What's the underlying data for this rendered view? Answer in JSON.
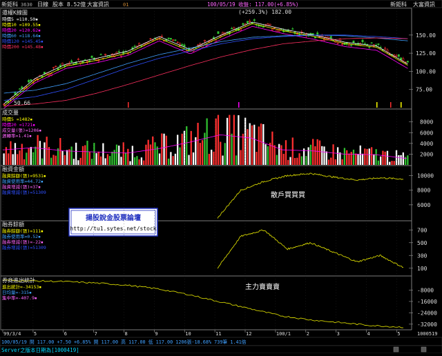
{
  "header": {
    "stock_name": "新鉅科",
    "code": "3630",
    "period": "日線",
    "capital": "股本 8.52億",
    "broker": "大富資訊",
    "page": "01",
    "quote": "100/05/19 收盤: 117.00(+6.85%)",
    "name_right": "新鉅科",
    "broker_right": "大富資訊"
  },
  "colors": {
    "up": "#ff3030",
    "down": "#30c030",
    "ma5": "#ffffff",
    "ma10": "#ffff00",
    "ma20": "#ff00ff",
    "ma60": "#40a0ff",
    "ma120": "#3050ff",
    "ma200": "#ff3060",
    "trace": "#d4d400"
  },
  "panel1": {
    "title": "還權K線圖",
    "legends": [
      "時價5 =110.50▪",
      "時價10 =109.55▪",
      "時價20 =120.62▪",
      "時價60 =118.64▪",
      "時價120 =145.45▪",
      "時價200 =145.48▪"
    ],
    "peak_label": "(+259.3%) 182.00",
    "low_label": "50.66"
  },
  "panel2": {
    "title": "成交量",
    "legends": [
      "時價5 =1482▪",
      "時價20 =1721▪",
      "成交量(張)=1206▪",
      "週轉率=1.41▪"
    ]
  },
  "panel3": {
    "title": "融資金額",
    "legends": [
      "融資餘額(張)=9531▪",
      "融資使用率=44.72▪",
      "融資增減(張)=37▪",
      "融資增減(張)=51309"
    ],
    "annotation": "散戶買買買"
  },
  "panel4": {
    "title": "融券餘額",
    "legends": [
      "融券餘額(張)=111▪",
      "融券使用率=0.52▪",
      "融券增減(張)=-22▪",
      "融券增減(張)=51309"
    ]
  },
  "panel5": {
    "title": "券商進出統計",
    "legends": [
      "進出統計=-34153▪",
      "日均量=-315▪",
      "集中率=-407.9▪"
    ],
    "annotation": "主力賣賣賣"
  },
  "watermark": {
    "title": "揚股說金股票論壇",
    "url": "http://tu1.sytes.net/stock"
  },
  "xaxis": {
    "labels": [
      "99/3/4",
      "5",
      "6",
      "7",
      "8",
      "9",
      "10",
      "11",
      "12",
      "100/1",
      "2",
      "3",
      "4",
      "5"
    ],
    "end_label": "1000519"
  },
  "status": {
    "line1": "100/05/19 開 117.00 +7.50 +6.85% 開 117.00 高 117.00 低 117.00 1206張-18.68% 739筆 1.41倍",
    "line2": "Server之版本日期為[1000419]"
  },
  "chart_data": [
    {
      "type": "line",
      "title": "還權K線圖",
      "x": [
        "99/3/4",
        "5",
        "6",
        "7",
        "8",
        "9",
        "10",
        "11",
        "12",
        "100/1",
        "2",
        "3",
        "4",
        "5"
      ],
      "yticks": [
        150,
        125,
        100,
        75
      ],
      "ylim": [
        50,
        185
      ],
      "series": [
        {
          "name": "時價5",
          "values": [
            55,
            90,
            110,
            118,
            128,
            148,
            130,
            150,
            168,
            158,
            150,
            140,
            135,
            110
          ]
        },
        {
          "name": "時價120",
          "values": [
            60,
            65,
            75,
            90,
            105,
            118,
            128,
            138,
            145,
            148,
            150,
            150,
            148,
            145
          ]
        },
        {
          "name": "時價200",
          "values": [
            52,
            55,
            60,
            70,
            82,
            95,
            108,
            120,
            130,
            138,
            142,
            145,
            146,
            145
          ]
        }
      ]
    },
    {
      "type": "bar",
      "title": "成交量",
      "categories": [
        "99/3/4",
        "5",
        "6",
        "7",
        "8",
        "9",
        "10",
        "11",
        "12",
        "100/1",
        "2",
        "3",
        "4",
        "5"
      ],
      "yticks": [
        8000,
        6000,
        4000,
        2000
      ],
      "ylim": [
        0,
        9500
      ],
      "values": [
        2800,
        3200,
        2600,
        2400,
        2200,
        3000,
        4200,
        5600,
        5000,
        2800,
        2600,
        2000,
        1900,
        1200
      ]
    },
    {
      "type": "line",
      "title": "融資金額",
      "x": [
        "9",
        "10",
        "11",
        "12",
        "100/1",
        "2",
        "3",
        "4",
        "5"
      ],
      "yticks": [
        10000,
        8000,
        6000
      ],
      "ylim": [
        4000,
        11000
      ],
      "values": [
        4200,
        8000,
        9200,
        10000,
        10300,
        9800,
        9400,
        9700,
        9531
      ]
    },
    {
      "type": "line",
      "title": "融券餘額",
      "x": [
        "9",
        "10",
        "11",
        "12",
        "100/1",
        "2",
        "3",
        "4",
        "5"
      ],
      "yticks": [
        700,
        500,
        300,
        100
      ],
      "ylim": [
        0,
        800
      ],
      "values": [
        100,
        600,
        700,
        400,
        500,
        350,
        200,
        300,
        111
      ]
    },
    {
      "type": "line",
      "title": "券商進出統計",
      "x": [
        "99/3/4",
        "5",
        "6",
        "7",
        "8",
        "9",
        "10",
        "11",
        "12",
        "100/1",
        "2",
        "3",
        "4",
        "5"
      ],
      "yticks": [
        -8000,
        -16000,
        -24000,
        -32000
      ],
      "ylim": [
        -35000,
        0
      ],
      "values": [
        -1000,
        -1500,
        -2000,
        -3000,
        -4500,
        -7000,
        -11000,
        -16000,
        -21000,
        -26000,
        -29000,
        -31000,
        -33000,
        -34153
      ]
    }
  ]
}
